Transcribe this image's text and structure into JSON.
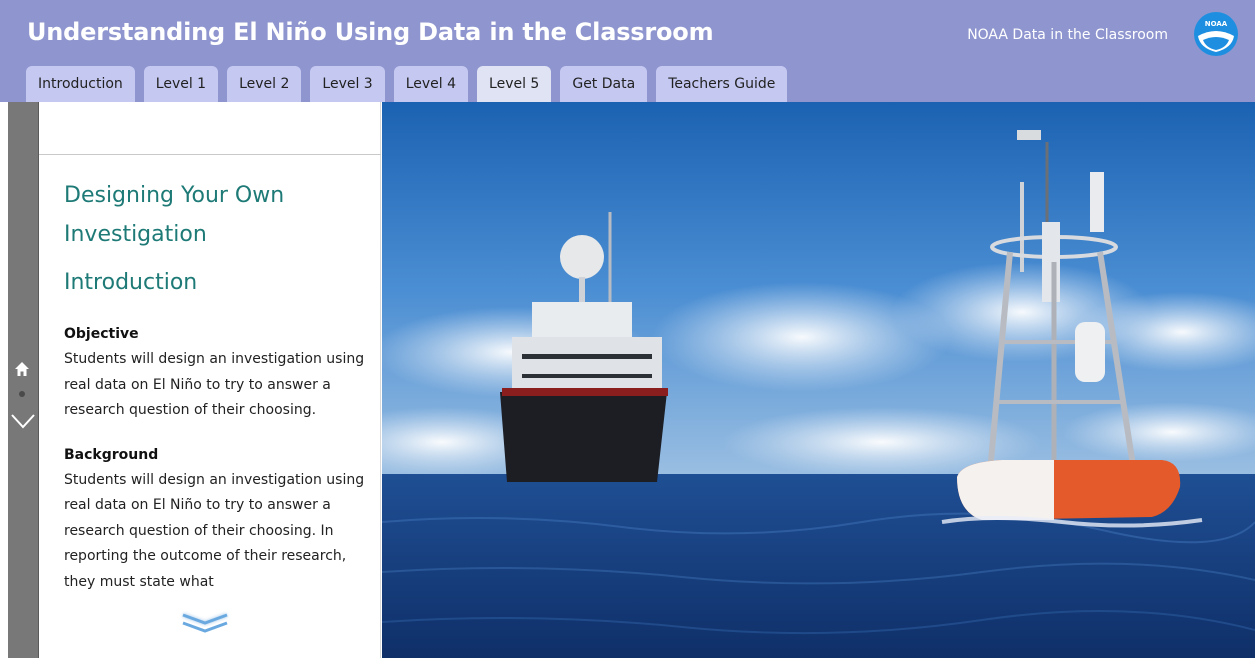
{
  "header": {
    "title": "Understanding El Niño Using Data in the Classroom",
    "brand": "NOAA Data in the Classroom",
    "logo_text": "NOAA",
    "logo_icon": "noaa-logo",
    "colors": {
      "bar": "#8f96cf",
      "tab": "#c5c9f2",
      "tab_active": "#e0e3f4"
    }
  },
  "tabs": [
    {
      "label": "Introduction"
    },
    {
      "label": "Level 1"
    },
    {
      "label": "Level 2"
    },
    {
      "label": "Level 3"
    },
    {
      "label": "Level 4"
    },
    {
      "label": "Level 5",
      "active": true
    },
    {
      "label": "Get Data"
    },
    {
      "label": "Teachers Guide"
    }
  ],
  "rail": {
    "icons": [
      "home-icon",
      "dot-indicator",
      "chevron-down-icon"
    ]
  },
  "panel": {
    "title": "Designing Your Own Investigation",
    "subtitle": "Introduction",
    "objective": {
      "heading": "Objective",
      "text": "Students will design an investigation using real data on El Niño to try to answer a research question of their choosing."
    },
    "background": {
      "heading": "Background",
      "text": "Students will design an investigation using real data on El Niño to try to answer a research question of their choosing. In reporting the outcome of their research, they must state what"
    },
    "scroll_icon": "double-chevron-down-icon",
    "heading_color": "#1e7a76"
  },
  "photo": {
    "icon": "ship-and-buoy-photo"
  }
}
